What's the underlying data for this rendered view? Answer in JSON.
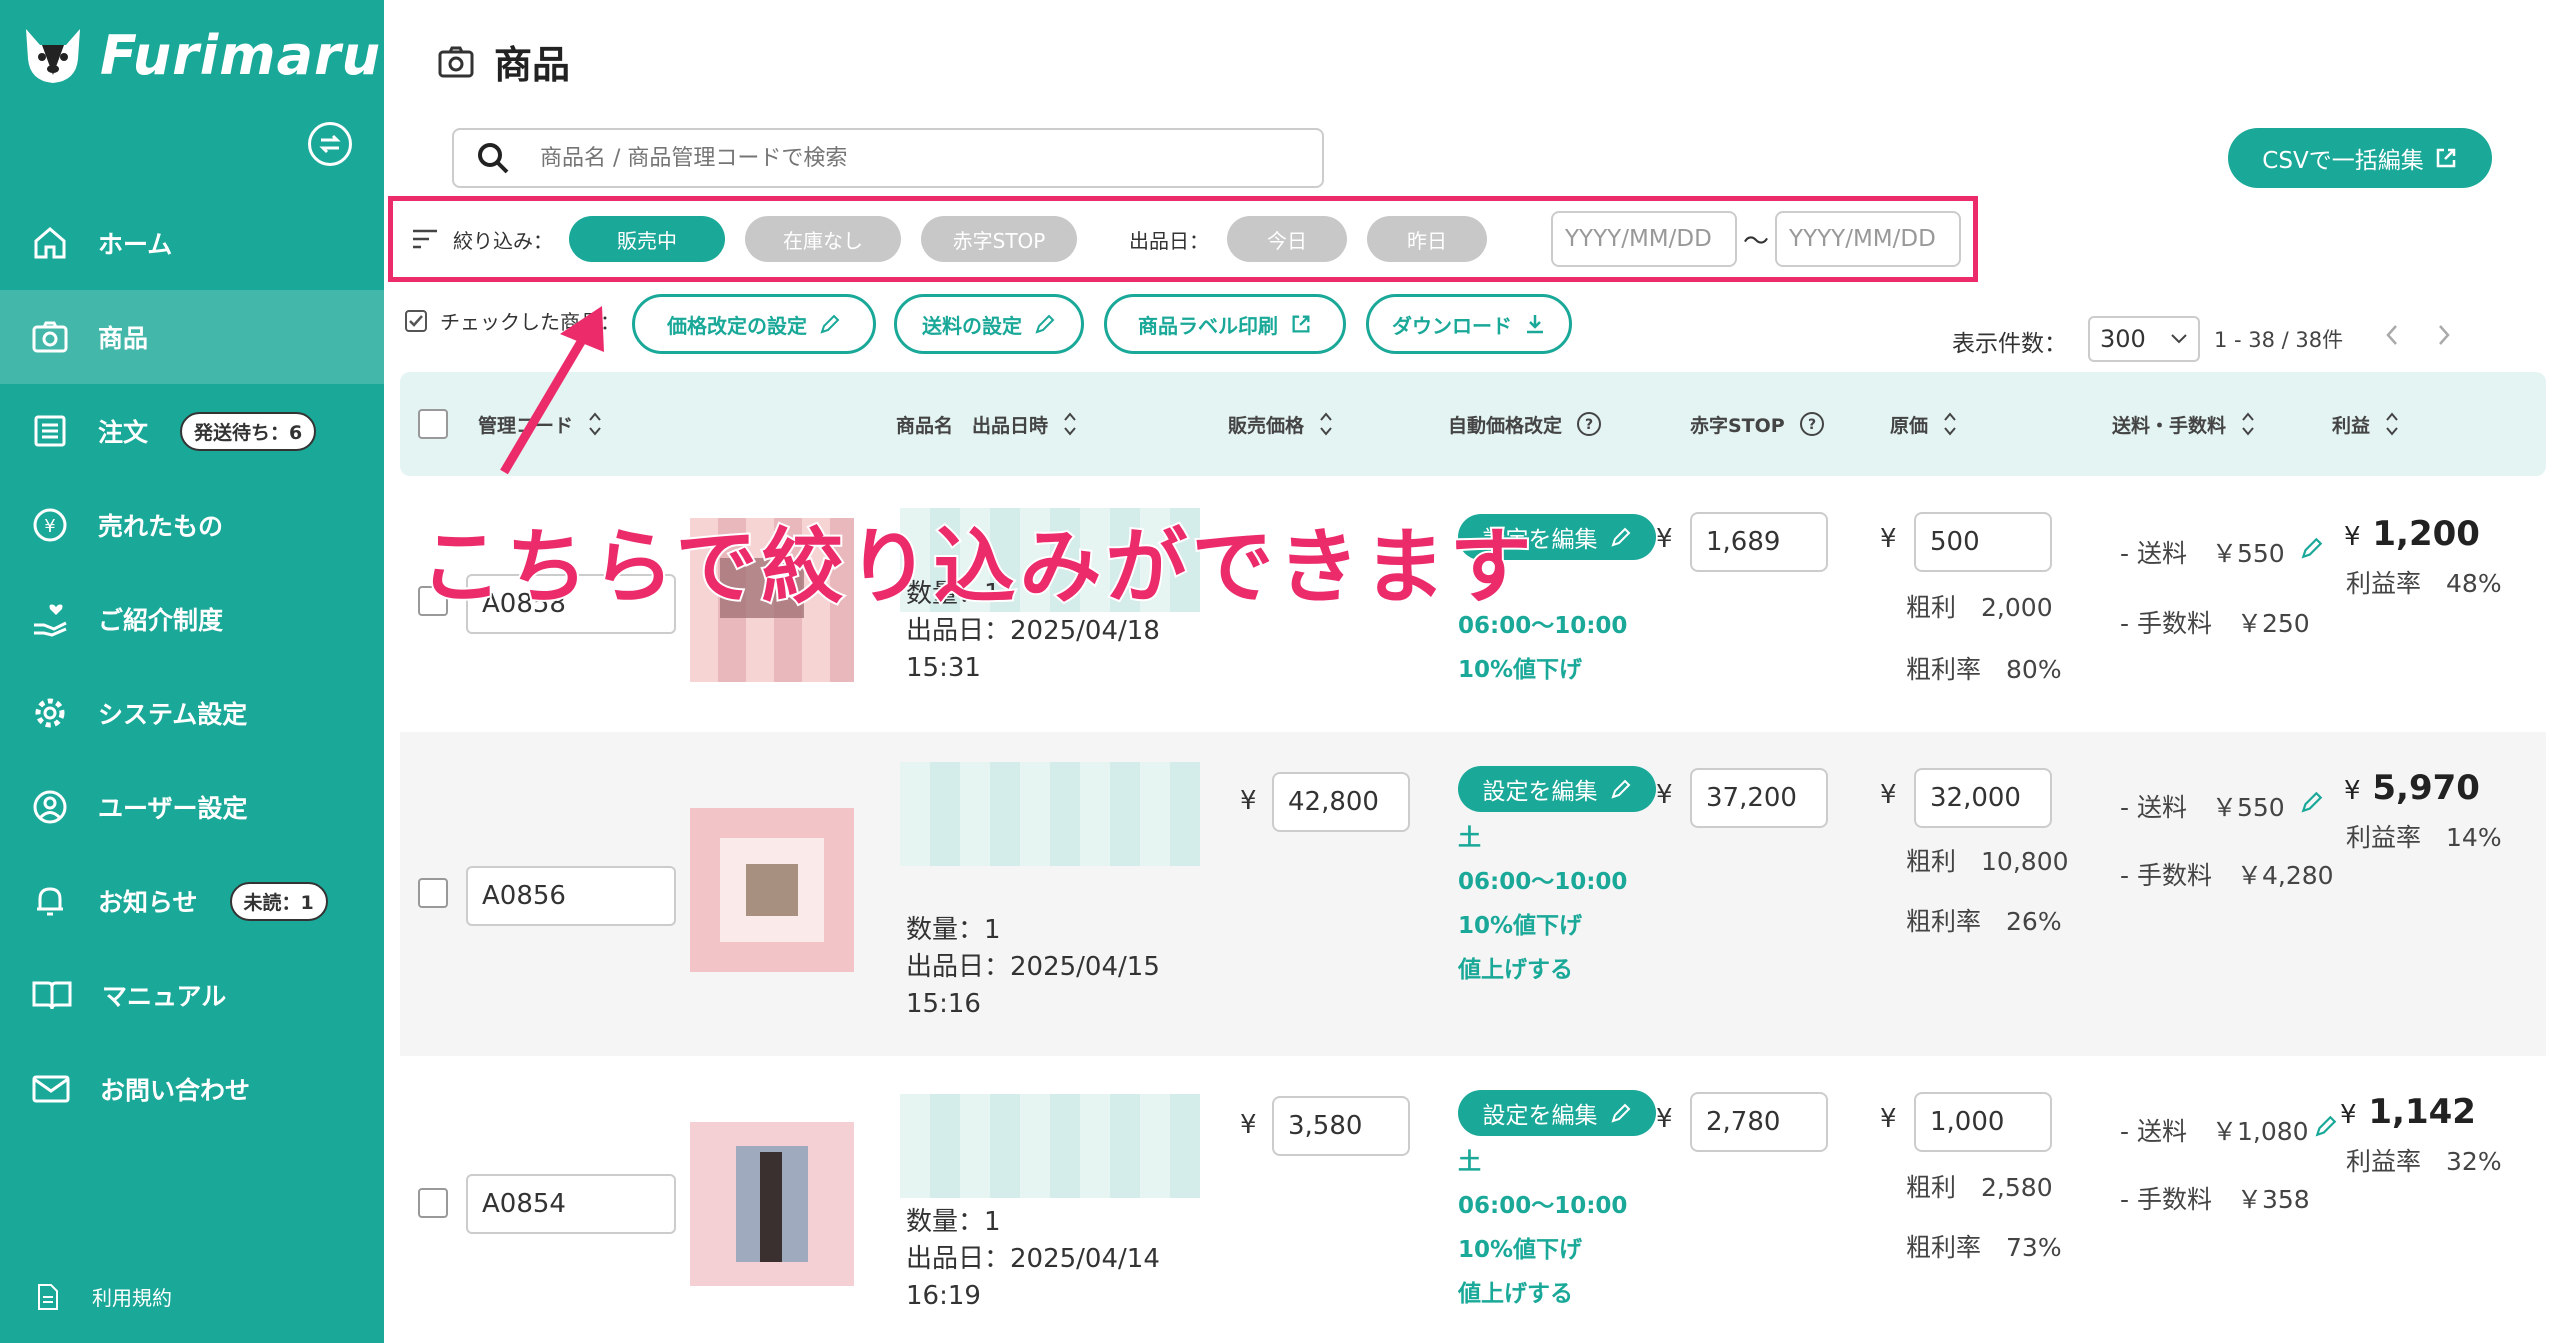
{
  "app": {
    "name": "Furimaru?"
  },
  "sidebar": {
    "items": [
      {
        "label": "ホーム",
        "icon": "home-icon"
      },
      {
        "label": "商品",
        "icon": "camera-icon",
        "active": true
      },
      {
        "label": "注文",
        "icon": "list-icon",
        "badge": "発送待ち：6"
      },
      {
        "label": "売れたもの",
        "icon": "yen-icon"
      },
      {
        "label": "ご紹介制度",
        "icon": "referral-icon"
      },
      {
        "label": "システム設定",
        "icon": "gear-icon"
      },
      {
        "label": "ユーザー設定",
        "icon": "user-icon"
      },
      {
        "label": "お知らせ",
        "icon": "bell-icon",
        "badge": "未読：1"
      },
      {
        "label": "マニュアル",
        "icon": "book-icon"
      },
      {
        "label": "お問い合わせ",
        "icon": "mail-icon"
      }
    ],
    "terms": "利用規約"
  },
  "page": {
    "title": "商品"
  },
  "search": {
    "placeholder": "商品名 / 商品管理コードで検索"
  },
  "csv_button": "CSVで一括編集",
  "filter": {
    "label": "絞り込み：",
    "pills": [
      "販売中",
      "在庫なし",
      "赤字STOP"
    ],
    "date_label": "出品日：",
    "date_pills": [
      "今日",
      "昨日"
    ],
    "date_placeholder": "YYYY/MM/DD",
    "tilde": "〜"
  },
  "actions": {
    "checked_label": "チェックした商品：",
    "buttons": [
      "価格改定の設定",
      "送料の設定",
      "商品ラベル印刷",
      "ダウンロード"
    ]
  },
  "pagination": {
    "per_page_label": "表示件数：",
    "per_page": "300",
    "range": "1 - 38 / 38件"
  },
  "columns": [
    "管理コード",
    "商品名　出品日時",
    "販売価格",
    "自動価格改定",
    "赤字STOP",
    "原価",
    "送料・手数料",
    "利益"
  ],
  "overlay_text": "こちらで絞り込みができます",
  "rows": [
    {
      "code": "A0858",
      "price": "",
      "auto": {
        "edit": "設定を編集",
        "day": "",
        "time": "06:00〜10:00",
        "rule": "10%値下げ",
        "extra": ""
      },
      "stop": "1,689",
      "cost": "500",
      "gross": "2,000",
      "gross_rate": "80%",
      "ship": "￥550",
      "fee": "￥250",
      "profit": "1,200",
      "profit_rate": "48%",
      "qty": "数量：1",
      "date": "出品日：2025/04/18",
      "time": "15:31"
    },
    {
      "code": "A0856",
      "price": "42,800",
      "auto": {
        "edit": "設定を編集",
        "day": "土",
        "time": "06:00〜10:00",
        "rule": "10%値下げ",
        "extra": "値上げする"
      },
      "stop": "37,200",
      "cost": "32,000",
      "gross": "10,800",
      "gross_rate": "26%",
      "ship": "￥550",
      "fee": "￥4,280",
      "profit": "5,970",
      "profit_rate": "14%",
      "qty": "数量：1",
      "date": "出品日：2025/04/15",
      "time": "15:16"
    },
    {
      "code": "A0854",
      "price": "3,580",
      "auto": {
        "edit": "設定を編集",
        "day": "土",
        "time": "06:00〜10:00",
        "rule": "10%値下げ",
        "extra": "値上げする"
      },
      "stop": "2,780",
      "cost": "1,000",
      "gross": "2,580",
      "gross_rate": "73%",
      "ship": "￥1,080",
      "fee": "￥358",
      "profit": "1,142",
      "profit_rate": "32%",
      "qty": "数量：1",
      "date": "出品日：2025/04/14",
      "time": "16:19"
    }
  ],
  "labels": {
    "yen": "¥",
    "gross": "粗利",
    "gross_rate": "粗利率",
    "ship": "- 送料",
    "fee": "- 手数料",
    "profit_rate": "利益率"
  },
  "colors": {
    "accent": "#1aa898",
    "highlight": "#ec2b6b"
  }
}
